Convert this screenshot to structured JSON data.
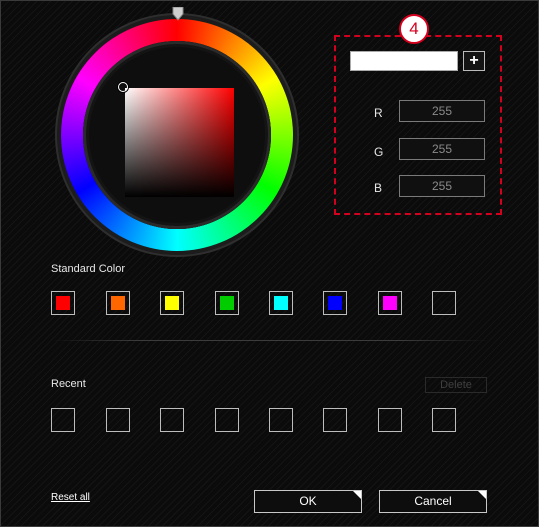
{
  "color_picker": {
    "hue_ring": {
      "hue_deg": 0
    },
    "sv_square": {
      "base_color": "#ff0000"
    }
  },
  "annotation": {
    "step_number": "4",
    "highlight_color": "#d3001e"
  },
  "rgb_panel": {
    "hex_value": "",
    "add_label": "+",
    "channels": [
      {
        "label": "R",
        "value": "255"
      },
      {
        "label": "G",
        "value": "255"
      },
      {
        "label": "B",
        "value": "255"
      }
    ]
  },
  "standard": {
    "label": "Standard Color",
    "colors": [
      "#ff0000",
      "#ff6600",
      "#ffff00",
      "#00cc00",
      "#00ffff",
      "#0000ff",
      "#ff00ff",
      ""
    ]
  },
  "recent": {
    "label": "Recent",
    "delete_label": "Delete",
    "colors": [
      "",
      "",
      "",
      "",
      "",
      "",
      "",
      ""
    ]
  },
  "footer": {
    "reset_label": "Reset all",
    "ok_label": "OK",
    "cancel_label": "Cancel"
  }
}
